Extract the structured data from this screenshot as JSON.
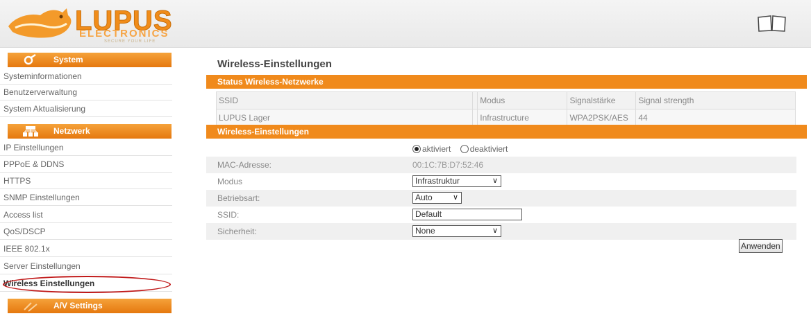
{
  "header": {
    "logo_text": "LUPUS",
    "logo_sub": "ELECTRONICS",
    "logo_tagline": "SECURE YOUR LIFE",
    "help_icon": "book-icon"
  },
  "sidebar": {
    "sections": [
      {
        "label": "System",
        "icon": "gear-icon",
        "items": [
          "Systeminformationen",
          "Benutzerverwaltung",
          "System Aktualisierung"
        ]
      },
      {
        "label": "Netzwerk",
        "icon": "network-icon",
        "items": [
          "IP Einstellungen",
          "PPPoE & DDNS",
          "HTTPS",
          "SNMP Einstellungen",
          "Access list",
          "QoS/DSCP",
          "IEEE 802.1x",
          "Server Einstellungen",
          "Wireless Einstellungen"
        ]
      },
      {
        "label": "A/V Settings",
        "icon": "av-icon",
        "items": []
      }
    ],
    "active_item": "Wireless Einstellungen",
    "highlight_color": "#c01818"
  },
  "main": {
    "title": "Wireless-Einstellungen",
    "status_panel": {
      "title": "Status Wireless-Netzwerke",
      "columns": [
        "SSID",
        "",
        "Modus",
        "Signalstärke",
        "Signal strength"
      ],
      "rows": [
        [
          "LUPUS Lager",
          "",
          "Infrastructure",
          "WPA2PSK/AES",
          "44"
        ]
      ]
    },
    "settings_panel": {
      "title": "Wireless-Einstellungen",
      "radio_on": "aktiviert",
      "radio_off": "deaktiviert",
      "mac_label": "MAC-Adresse:",
      "mac_value": "00:1C:7B:D7:52:46",
      "mode_label": "Modus",
      "mode_value": "Infrastruktur",
      "op_label": "Betriebsart:",
      "op_value": "Auto",
      "ssid_label": "SSID:",
      "ssid_value": "Default",
      "security_label": "Sicherheit:",
      "security_value": "None",
      "apply_label": "Anwenden"
    }
  },
  "colors": {
    "accent": "#f08a1c",
    "accent_dark": "#e5780f"
  }
}
